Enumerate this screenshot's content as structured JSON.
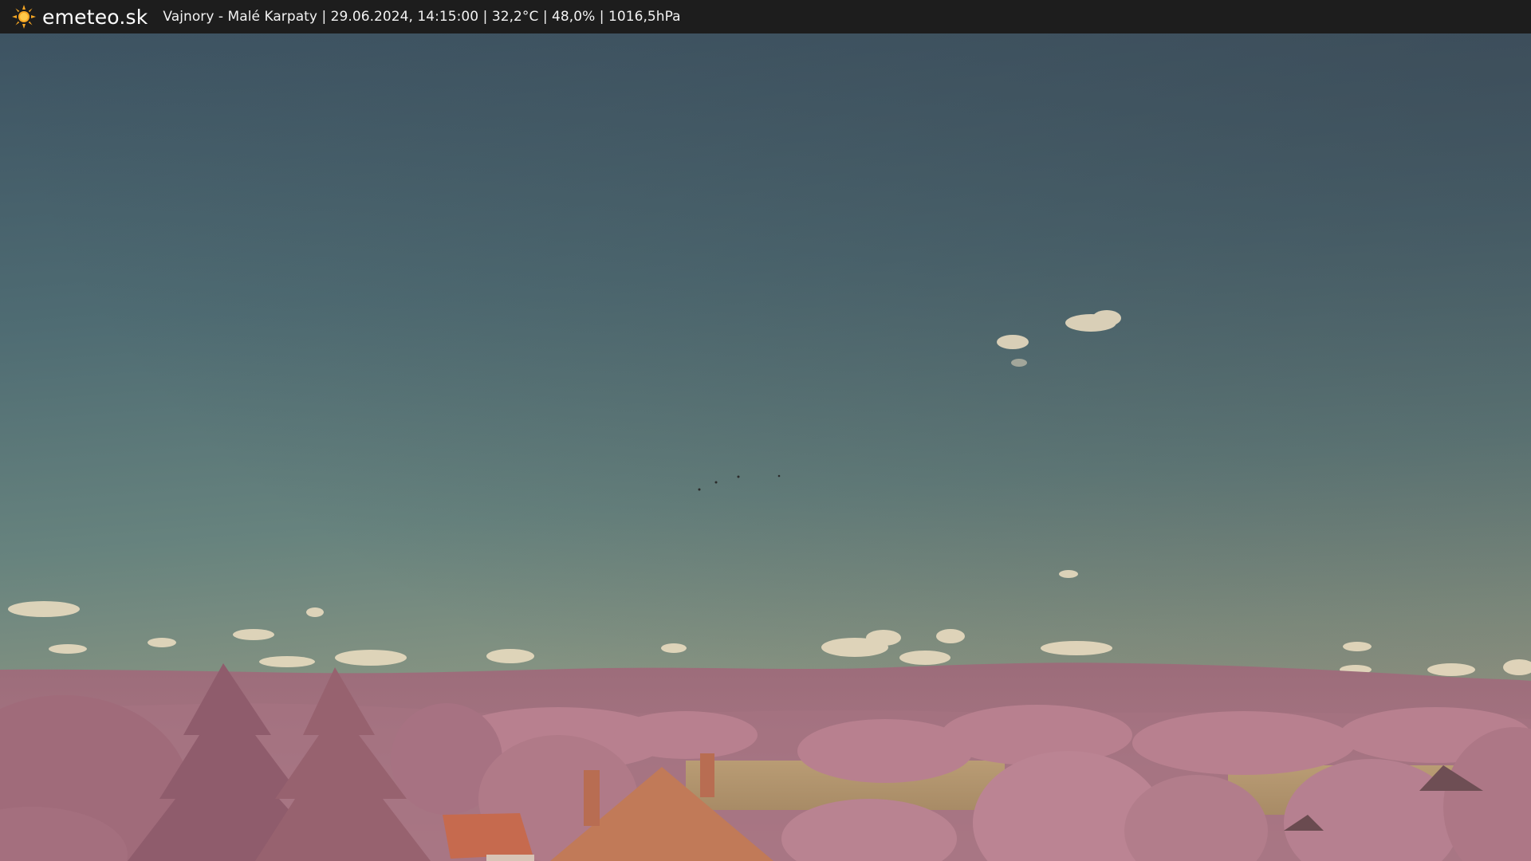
{
  "topbar": {
    "brand": "emeteo.sk",
    "logo_icon": "sun-icon",
    "caption": "Vajnory - Malé Karpaty | 29.06.2024, 14:15:00 | 32,2°C | 48,0% | 1016,5hPa"
  },
  "image": {
    "subject": "webcam-view",
    "colors": {
      "sky_top": "#3e5562",
      "sky_mid": "#5c7a7a",
      "sky_horizon": "#8e9a86",
      "hills": "#a0707e",
      "trees": "#b57b8c",
      "fields": "#b89a72",
      "roof": "#c0684c"
    }
  }
}
